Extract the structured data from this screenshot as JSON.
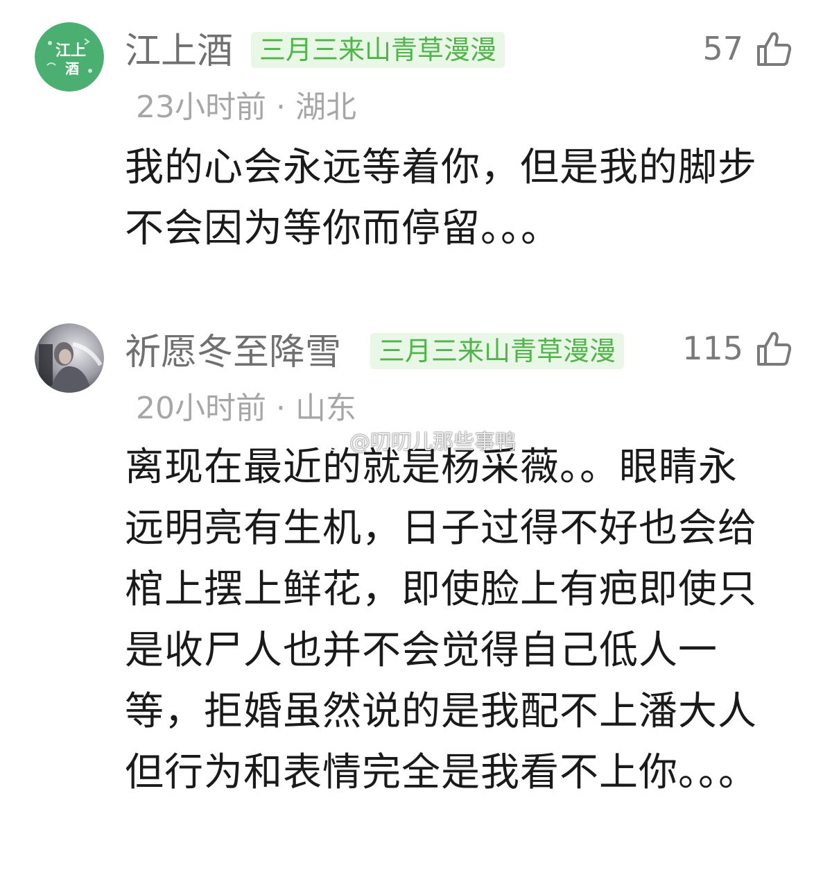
{
  "comments": [
    {
      "avatar_text": "江上酒",
      "username": "江上酒",
      "badge": "三月三来山青草漫漫",
      "likes": "57",
      "meta": "23小时前 · 湖北",
      "text": "我的心会永远等着你，但是我的脚步不会因为等你而停留。。。"
    },
    {
      "username": "祈愿冬至降雪",
      "badge": "三月三来山青草漫漫",
      "likes": "115",
      "meta": "20小时前 · 山东",
      "text": "离现在最近的就是杨采薇。。眼睛永远明亮有生机，日子过得不好也会给棺上摆上鲜花，即使脸上有疤即使只是收尸人也并不会觉得自己低人一等，拒婚虽然说的是我配不上潘大人但行为和表情完全是我看不上你。。。"
    }
  ],
  "watermark": "@叨叨儿那些事鸭",
  "icons": {
    "like": "thumbs-up-icon",
    "weibo": "weibo-logo-icon"
  },
  "colors": {
    "badge_bg": "#e9f7e7",
    "badge_text": "#4fb548",
    "username": "#707070",
    "meta": "#a6a6a6",
    "body": "#1a1a1a",
    "avatar_green": "#4caf72"
  }
}
